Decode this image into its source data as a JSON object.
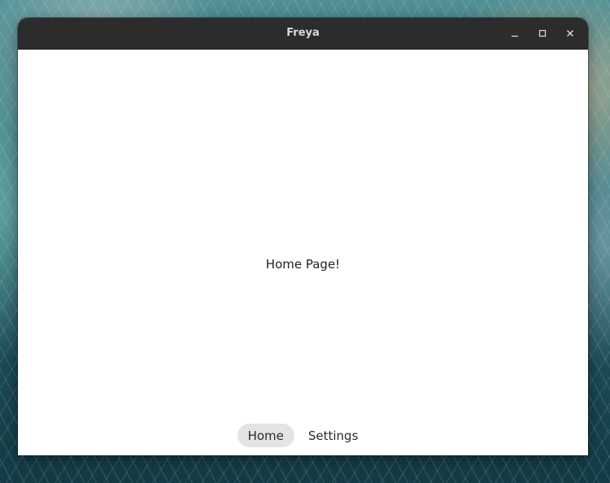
{
  "window": {
    "title": "Freya",
    "controls": {
      "minimize_icon": "minimize-icon",
      "maximize_icon": "maximize-icon",
      "close_icon": "close-icon"
    }
  },
  "main": {
    "message": "Home Page!"
  },
  "tabs": [
    {
      "label": "Home",
      "active": true
    },
    {
      "label": "Settings",
      "active": false
    }
  ],
  "colors": {
    "titlebar": "#2c2c2c",
    "title_text": "#d8d8d8",
    "content_bg": "#ffffff",
    "active_tab_bg": "#e4e4e4"
  }
}
